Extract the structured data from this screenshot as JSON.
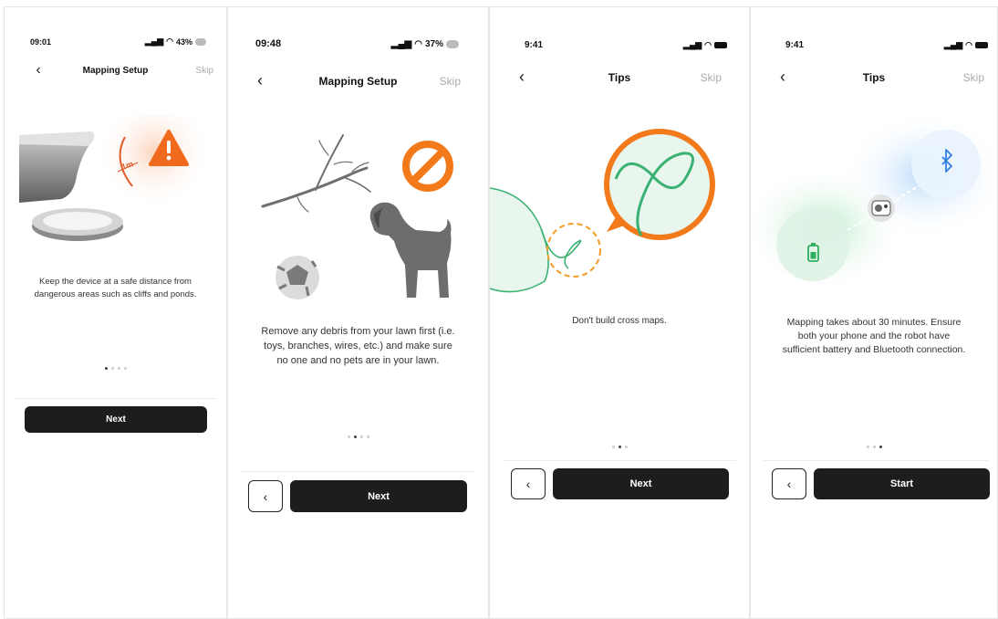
{
  "screens": [
    {
      "status": {
        "time": "09:01",
        "battery": "43%"
      },
      "nav": {
        "back": "‹",
        "title": "Mapping Setup",
        "skip": "Skip"
      },
      "illustration": {
        "distance_label": "1m",
        "warning_icon": "warning-icon"
      },
      "message": "Keep the device at a safe distance from dangerous areas such as cliffs and ponds.",
      "pager": {
        "total": 4,
        "active": 0
      },
      "buttons": {
        "next": "Next"
      }
    },
    {
      "status": {
        "time": "09:48",
        "battery": "37%"
      },
      "nav": {
        "back": "‹",
        "title": "Mapping Setup",
        "skip": "Skip"
      },
      "illustration": {
        "prohibited_icon": "no-entry-icon"
      },
      "message": "Remove any debris from your lawn first (i.e. toys, branches, wires, etc.) and make sure no one and no pets are in your lawn.",
      "pager": {
        "total": 4,
        "active": 1
      },
      "buttons": {
        "back": "‹",
        "next": "Next"
      }
    },
    {
      "status": {
        "time": "9:41"
      },
      "nav": {
        "back": "‹",
        "title": "Tips",
        "skip": "Skip"
      },
      "message": "Don't build cross maps.",
      "pager": {
        "total": 3,
        "active": 1
      },
      "buttons": {
        "back": "‹",
        "next": "Next"
      }
    },
    {
      "status": {
        "time": "9:41"
      },
      "nav": {
        "back": "‹",
        "title": "Tips",
        "skip": "Skip"
      },
      "illustration": {
        "bluetooth_icon": "bluetooth-icon",
        "battery_icon": "battery-icon"
      },
      "message": "Mapping takes about 30 minutes. Ensure both your phone and the robot have sufficient battery and Bluetooth connection.",
      "pager": {
        "total": 3,
        "active": 2
      },
      "buttons": {
        "back": "‹",
        "start": "Start"
      }
    }
  ],
  "colors": {
    "primary_button": "#1d1d1d",
    "accent_orange": "#f27a1a",
    "path_green": "#3bb273",
    "bluetooth_blue": "#2f7ee6"
  }
}
